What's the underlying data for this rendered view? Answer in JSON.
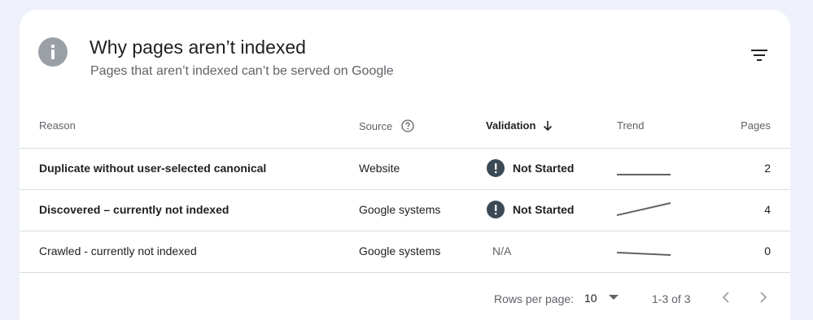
{
  "header": {
    "title": "Why pages aren’t indexed",
    "subtitle": "Pages that aren’t indexed can’t be served on Google"
  },
  "icons": {
    "header_icon": "info-icon",
    "filter": "filter-list-icon",
    "help": "help-circle-icon",
    "sort": "arrow-down-icon",
    "status": "exclamation-circle-icon",
    "dropdown": "caret-down-icon",
    "prev": "chevron-left-icon",
    "next": "chevron-right-icon"
  },
  "colors": {
    "background": "#eef1f9",
    "card": "#ffffff",
    "status_icon": "#3c4a55",
    "header_icon": "#9aa0a6",
    "divider": "#dadce0"
  },
  "table": {
    "columns": {
      "reason": "Reason",
      "source": "Source",
      "validation": "Validation",
      "trend": "Trend",
      "pages": "Pages"
    },
    "sorted_by": "Validation",
    "sort_direction": "descending",
    "rows": [
      {
        "reason": "Duplicate without user-selected canonical",
        "source": "Website",
        "validation": "Not Started",
        "pages": "2",
        "trend": [
          2,
          2
        ]
      },
      {
        "reason": "Discovered – currently not indexed",
        "source": "Google systems",
        "validation": "Not Started",
        "pages": "4",
        "trend": [
          0,
          4
        ]
      },
      {
        "reason": "Crawled - currently not indexed",
        "source": "Google systems",
        "validation": "N/A",
        "pages": "0",
        "trend": [
          1,
          0
        ]
      }
    ]
  },
  "footer": {
    "rows_per_page_label": "Rows per page:",
    "rows_per_page_value": "10",
    "range": "1-3 of 3"
  }
}
